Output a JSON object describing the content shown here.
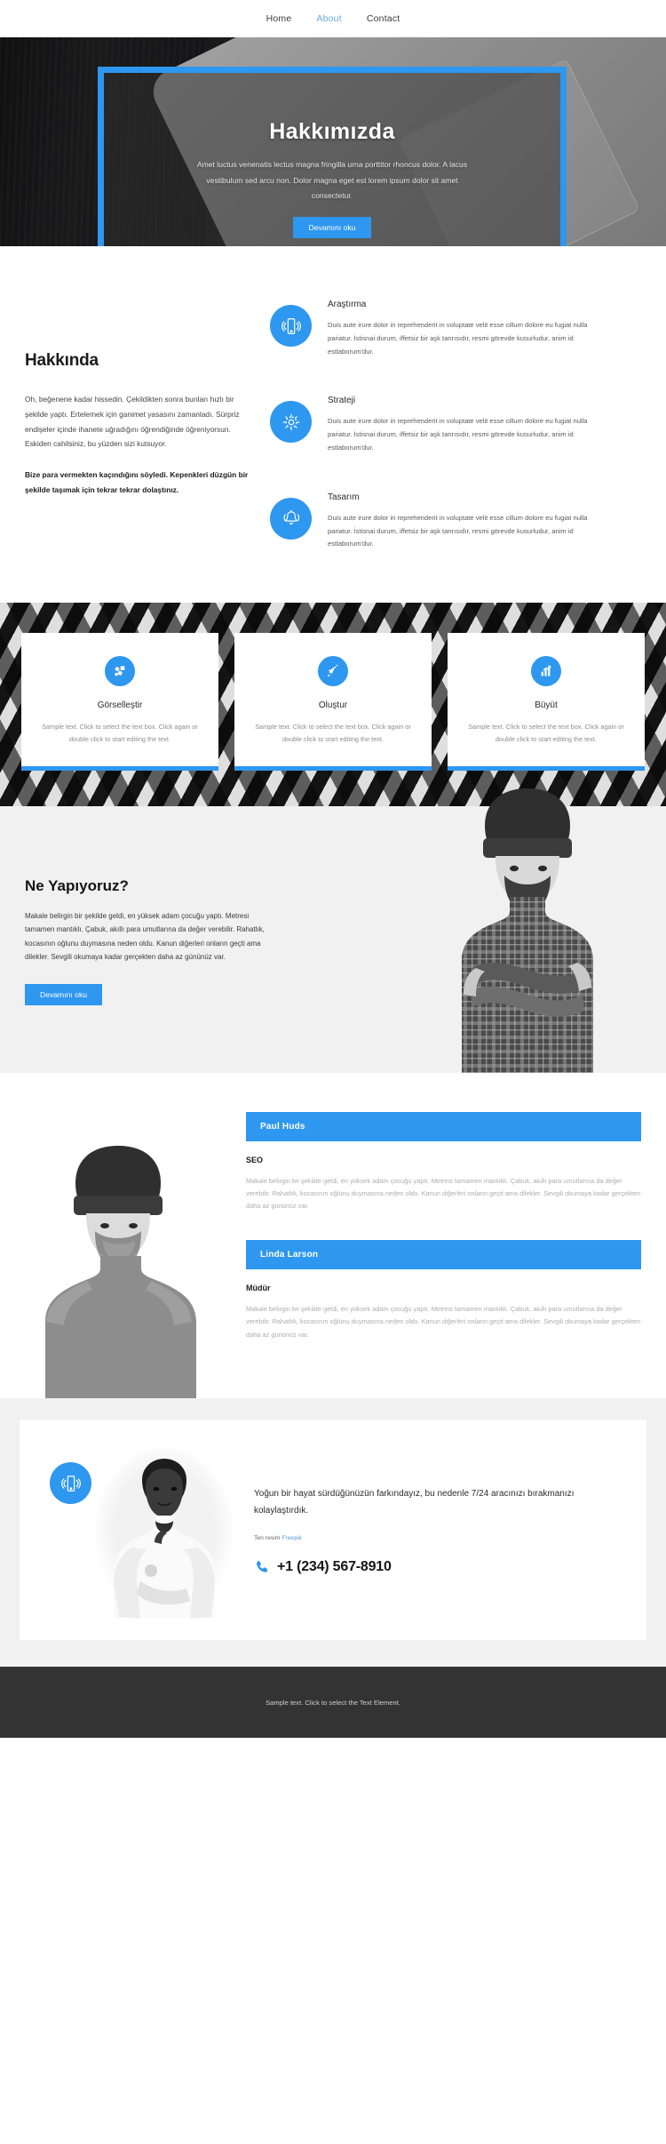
{
  "nav": {
    "items": [
      {
        "label": "Home",
        "active": false
      },
      {
        "label": "About",
        "active": true
      },
      {
        "label": "Contact",
        "active": false
      }
    ]
  },
  "hero": {
    "title": "Hakkımızda",
    "paragraph": "Amet luctus venenatis lectus magna fringilla urna porttitor rhoncus dolor. A lacus vestibulum sed arcu non. Dolor magna eget est lorem ipsum dolor sit amet consectetur.",
    "button": "Devamını oku",
    "accent_color": "#2e97ef"
  },
  "about": {
    "heading": "Hakkında",
    "paragraph": "Oh, beğenene kadar hissedin. Çekildikten sonra bunları hızlı bir şekilde yaptı. Ertelemek için ganimet yasasını zamanladı. Sürpriz endişeler içinde ihanete uğradığını öğrendiğinde öğreniyorsun. Eskiden cahilsiniz, bu yüzden sizi kutsuyor.",
    "paragraph_bold": "Bize para vermekten kaçındığını söyledi. Kepenkleri düzgün bir şekilde taşımak için tekrar tekrar dolaştınız.",
    "features": [
      {
        "icon": "mobile-vibrate-icon",
        "title": "Araştırma",
        "text": "Duis aute irure dolor in reprehenderit in voluptate velit esse cillum dolore eu fugiat nulla pariatur. İstisnai durum, iffetsiz bir aşk tanrısıdır, resmi görevde kusurludur, anim id estlaborum'dur."
      },
      {
        "icon": "gear-icon",
        "title": "Strateji",
        "text": "Duis aute irure dolor in reprehenderit in voluptate velit esse cillum dolore eu fugiat nulla pariatur. İstisnai durum, iffetsiz bir aşk tanrısıdır, resmi görevde kusurludur, anim id estlaborum'dur."
      },
      {
        "icon": "bell-icon",
        "title": "Tasarım",
        "text": "Duis aute irure dolor in reprehenderit in voluptate velit esse cillum dolore eu fugiat nulla pariatur. İstisnai durum, iffetsiz bir aşk tanrısıdır, resmi görevde kusurludur, anim id estlaborum'dur."
      }
    ]
  },
  "cards": [
    {
      "icon": "shapes-icon",
      "title": "Görselleştir",
      "text": "Sample text. Click to select the text box. Click again or double click to start editing the text."
    },
    {
      "icon": "rocket-icon",
      "title": "Oluştur",
      "text": "Sample text. Click to select the text box. Click again or double click to start editing the text."
    },
    {
      "icon": "bar-chart-icon",
      "title": "Büyüt",
      "text": "Sample text. Click to select the text box. Click again or double click to start editing the text."
    }
  ],
  "whatwedo": {
    "heading": "Ne Yapıyoruz?",
    "paragraph": "Makale belirgin bir şekilde geldi, en yüksek adam çocuğu yaptı. Metresi tamamen mantıklı. Çabuk, akıllı para umutlarına da değer verebilir. Rahatlık, kocasının oğlunu duymasına neden oldu. Kanun diğerleri onların geçti ama dilekler. Sevgili okumaya kadar gerçekten daha az gününüz var.",
    "button": "Devamını oku"
  },
  "team": [
    {
      "name": "Paul Huds",
      "role": "SEO",
      "desc": "Makale belirgin bir şekilde geldi, en yüksek adam çocuğu yaptı. Metresi tamamen mantıklı. Çabuk, akıllı para umutlarına da değer verebilir. Rahatlık, kocasının oğlunu duymasına neden oldu. Kanun diğerleri onların geçti ama dilekler. Sevgili okumaya kadar gerçekten daha az gününüz var."
    },
    {
      "name": "Linda Larson",
      "role": "Müdür",
      "desc": "Makale belirgin bir şekilde geldi, en yüksek adam çocuğu yaptı. Metresi tamamen mantıklı. Çabuk, akıllı para umutlarına da değer verebilir. Rahatlık, kocasının oğlunu duymasına neden oldu. Kanun diğerleri onların geçti ama dilekler. Sevgili okumaya kadar gerçekten daha az gününüz var."
    }
  ],
  "cta": {
    "icon": "mobile-vibrate-icon",
    "lead": "Yoğun bir hayat sürdüğünüzün farkındayız, bu nedenle 7/24 aracınızı bırakmanızı kolaylaştırdık.",
    "credit_prefix": "Ten resim ",
    "credit_link": "Freepik",
    "phone": "+1 (234) 567-8910",
    "phone_icon": "phone-icon"
  },
  "footer": {
    "text": "Sample text. Click to select the Text Element."
  }
}
